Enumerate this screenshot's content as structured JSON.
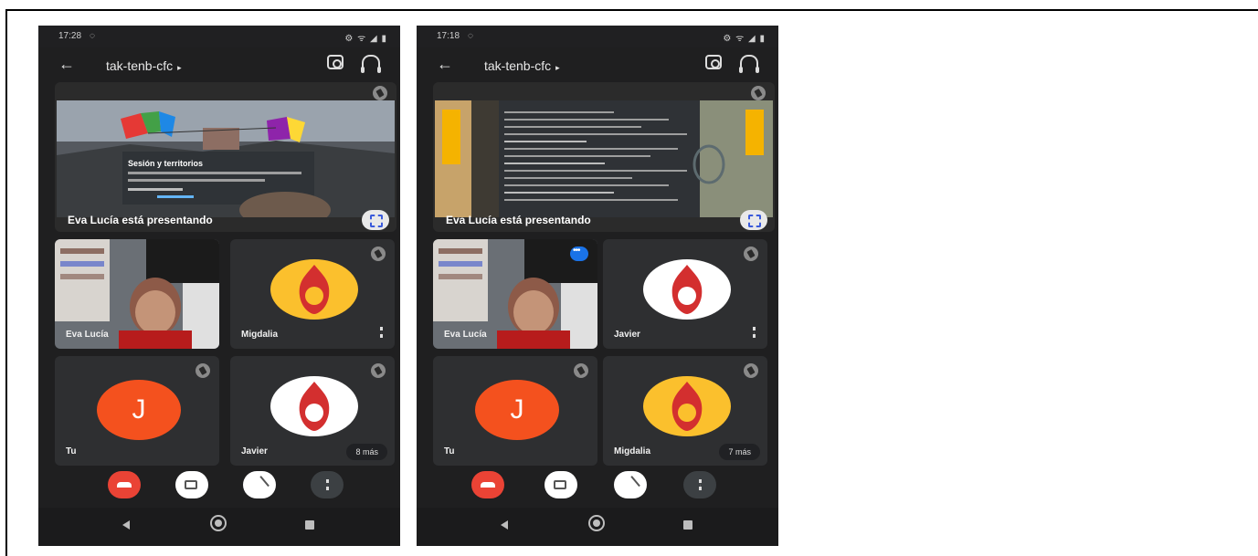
{
  "screens": [
    {
      "status_time": "17:28",
      "status_icons": "⚙ ᯤ ◢ ▮",
      "meeting_code": "tak-tenb-cfc",
      "presentation": {
        "label": "Eva Lucía está presentando",
        "slide_title": "Sesión y territorios"
      },
      "tiles": [
        {
          "name": "Eva Lucía"
        },
        {
          "name": "Migdalia"
        },
        {
          "name": "Tu",
          "avatar_letter": "J"
        },
        {
          "name": "Javier",
          "more": "8 más"
        }
      ]
    },
    {
      "status_time": "17:18",
      "status_icons": "⚙ ᯤ ◢ ▮",
      "meeting_code": "tak-tenb-cfc",
      "presentation": {
        "label": "Eva Lucía está presentando"
      },
      "tiles": [
        {
          "name": "Eva Lucía"
        },
        {
          "name": "Javier"
        },
        {
          "name": "Tu",
          "avatar_letter": "J"
        },
        {
          "name": "Migdalia",
          "more": "7 más"
        }
      ]
    }
  ],
  "colors": {
    "end_call": "#ea4335",
    "avatar_j": "#f4511e",
    "logo_yellow": "#fbc02d",
    "logo_red": "#d32f2f",
    "active_blue": "#1a73e8"
  },
  "icons": [
    "back-arrow-icon",
    "camera-switch-icon",
    "audio-output-icon",
    "pin-icon",
    "expand-icon",
    "end-call-icon",
    "camera-off-icon",
    "mic-off-icon",
    "more-options-icon"
  ]
}
